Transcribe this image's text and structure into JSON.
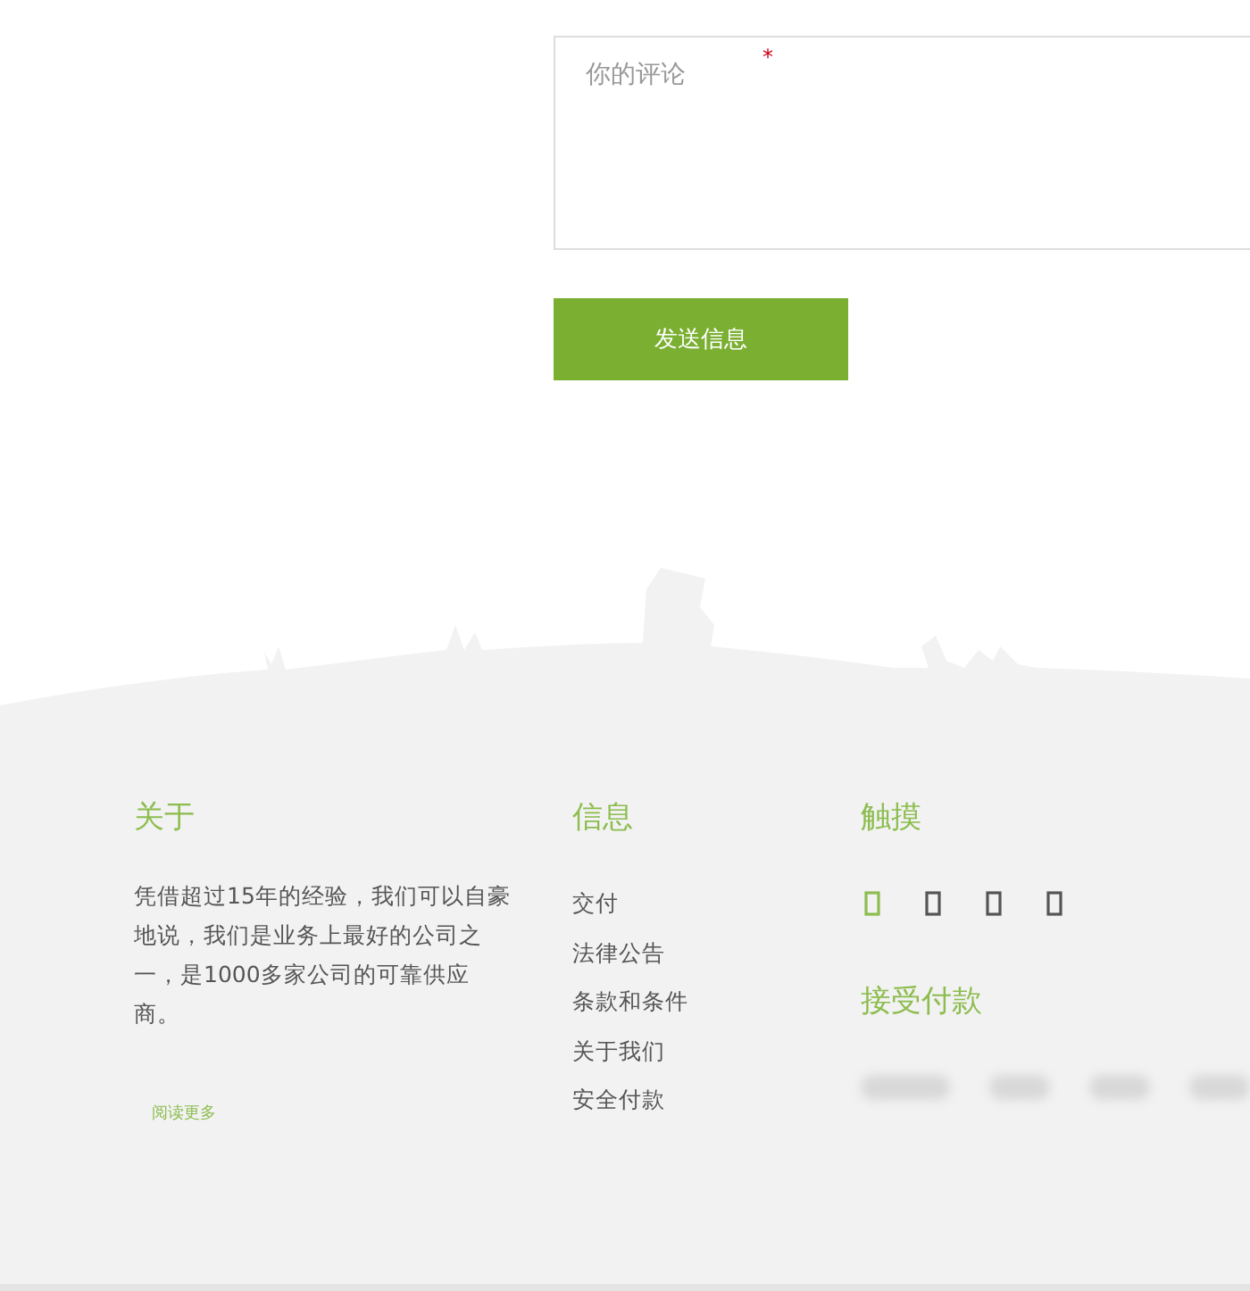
{
  "comment_form": {
    "placeholder": "你的评论",
    "required": true,
    "required_mark": "*",
    "submit": "发送信息"
  },
  "footer": {
    "about": {
      "heading": "关于",
      "text": "凭借超过15年的经验，我们可以自豪地说，我们是业务上最好的公司之一，是1000多家公司的可靠供应商。",
      "link": "阅读更多"
    },
    "info": {
      "heading": "信息",
      "links": [
        "交付",
        "法律公告",
        "条款和条件",
        "关于我们",
        "安全付款"
      ]
    },
    "touch": {
      "heading": "触摸",
      "social": [
        {
          "color": "#8dbd4f"
        },
        {
          "color": "#555555"
        },
        {
          "color": "#555555"
        },
        {
          "color": "#555555"
        }
      ]
    },
    "payments": {
      "heading": "接受付款",
      "logos": [
        {
          "kind": "wide"
        },
        {
          "kind": "narrow"
        },
        {
          "kind": "narrow"
        },
        {
          "kind": "narrow"
        }
      ]
    }
  }
}
